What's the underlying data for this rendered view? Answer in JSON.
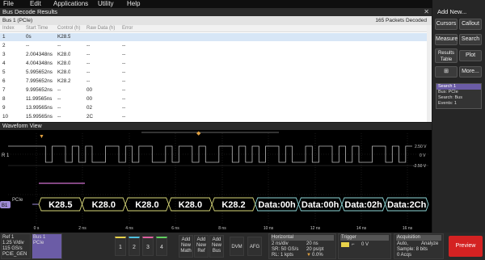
{
  "menu": [
    "File",
    "Edit",
    "Applications",
    "Utility",
    "Help"
  ],
  "results": {
    "title": "Bus Decode Results",
    "close": "✕",
    "bus_tab": "Bus 1 (PCIe)",
    "count": "165 Packets Decoded",
    "columns": [
      "Index",
      "Start Time",
      "Control (h)",
      "Raw Data (h)",
      "Error"
    ],
    "rows": [
      [
        "1",
        "0s",
        "K28.5",
        "",
        ""
      ],
      [
        "2",
        "--",
        "--",
        "--",
        "--"
      ],
      [
        "3",
        "2.004348ns",
        "K28.0",
        "--",
        "--"
      ],
      [
        "4",
        "4.004348ns",
        "K28.0",
        "--",
        "--"
      ],
      [
        "5",
        "5.995652ns",
        "K28.0",
        "--",
        "--"
      ],
      [
        "6",
        "7.995652ns",
        "K28.2",
        "--",
        "--"
      ],
      [
        "7",
        "9.995652ns",
        "--",
        "00",
        "--"
      ],
      [
        "8",
        "11.99565ns",
        "--",
        "00",
        "--"
      ],
      [
        "9",
        "13.99565ns",
        "--",
        "02",
        "--"
      ],
      [
        "10",
        "15.99565ns",
        "--",
        "2C",
        "--"
      ]
    ]
  },
  "waveform": {
    "title": "Waveform View",
    "ch_label": "R 1",
    "bus_label": "B1",
    "bus_name": "PCIe",
    "bus_segments": [
      "K28.5",
      "K28.0",
      "K28.0",
      "K28.0",
      "K28.2",
      "Data:00h",
      "Data:00h",
      "Data:02h",
      "Data:2Ch"
    ],
    "volt_labels": [
      "2.50 V",
      "0 V",
      "-2.50 V"
    ],
    "time_labels": [
      "0 s",
      "2 ns",
      "4 ns",
      "6 ns",
      "8 ns",
      "10 ns",
      "12 ns",
      "14 ns",
      "16 ns"
    ]
  },
  "right": {
    "add_new": "Add New...",
    "buttons": [
      "Cursors",
      "Callout",
      "Measure",
      "Search",
      "Results Table",
      "Plot",
      "",
      "More..."
    ],
    "search_title": "Search 1",
    "search_lines": [
      "Bus: PCIe",
      "Search: Bus",
      "Events: 1"
    ]
  },
  "bottom": {
    "ref1": [
      "Ref 1",
      "1.25 V/div",
      "115 GS/s",
      "PCIE_GEN"
    ],
    "bus1": [
      "Bus 1",
      "PCIe"
    ],
    "ch_buttons": [
      "1",
      "2",
      "3",
      "4"
    ],
    "add_buttons": [
      [
        "Add",
        "New",
        "Math"
      ],
      [
        "Add",
        "New",
        "Ref"
      ],
      [
        "Add",
        "New",
        "Bus"
      ]
    ],
    "dvm": "DVM",
    "afg": "AFG",
    "horizontal": [
      "Horizontal",
      "2 ns/div",
      "20 ns",
      "SR: 50 GS/s",
      "20 ps/pt",
      "RL: 1 kpts",
      "0.0%"
    ],
    "trigger": [
      "Trigger",
      "0 V"
    ],
    "acquisition": [
      "Acquisition",
      "Auto,",
      "Analyze",
      "Sample: 8 bits",
      "0 Acqs"
    ],
    "preview": "Preview"
  },
  "colors": {
    "accent": "#a08cd8",
    "bus": "#d9d97a",
    "bus_data": "#8fd9d9",
    "preview": "#d42222"
  }
}
